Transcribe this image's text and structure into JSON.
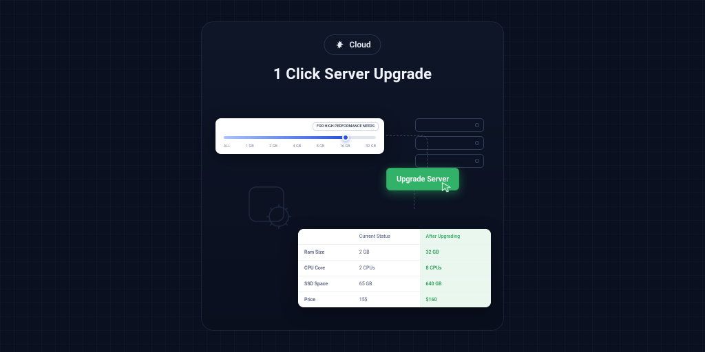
{
  "brand": {
    "name": "Cloud"
  },
  "title": "1 Click Server Upgrade",
  "slider": {
    "tooltip": "FOR HIGH PERFORMANCE NEEDS",
    "ticks": [
      "ALL",
      "1 GB",
      "2 GB",
      "4 GB",
      "8 GB",
      "16 GB",
      "32 GB"
    ]
  },
  "button": {
    "label": "Upgrade Server"
  },
  "table": {
    "headers": [
      "",
      "Current Status",
      "After Upgrading"
    ],
    "rows": [
      {
        "label": "Ram Size",
        "current": "2 GB",
        "after": "32 GB"
      },
      {
        "label": "CPU Core",
        "current": "2 CPUs",
        "after": "8 CPUs"
      },
      {
        "label": "SSD Space",
        "current": "65 GB",
        "after": "640 GB"
      },
      {
        "label": "Price",
        "current": "15$",
        "after": "$160"
      }
    ]
  }
}
